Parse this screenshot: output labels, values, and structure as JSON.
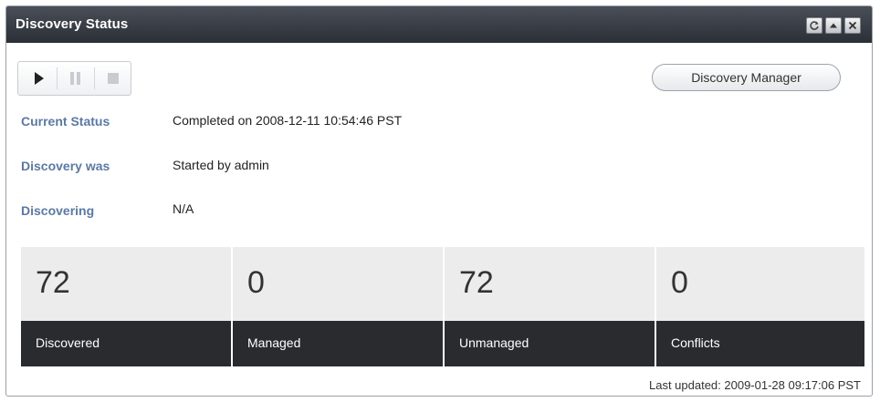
{
  "panel": {
    "title": "Discovery Status",
    "window_buttons": [
      "refresh-icon",
      "collapse-icon",
      "close-icon"
    ]
  },
  "toolbar": {
    "buttons": [
      "play-icon",
      "pause-icon",
      "stop-icon"
    ]
  },
  "discovery_manager_button": "Discovery Manager",
  "info": [
    {
      "label": "Current Status",
      "value": "Completed on 2008-12-11 10:54:46 PST"
    },
    {
      "label": "Discovery was",
      "value": "Started by admin"
    },
    {
      "label": "Discovering",
      "value": "N/A"
    }
  ],
  "stats": [
    {
      "value": "72",
      "label": "Discovered"
    },
    {
      "value": "0",
      "label": "Managed"
    },
    {
      "value": "72",
      "label": "Unmanaged"
    },
    {
      "value": "0",
      "label": "Conflicts"
    }
  ],
  "footer": "Last updated: 2009-01-28 09:17:06 PST",
  "colors": {
    "title_bar": "#2b2f36",
    "label_blue": "#5b79a6",
    "stat_background": "#ececec",
    "stat_label_background": "#2a2b2e"
  }
}
